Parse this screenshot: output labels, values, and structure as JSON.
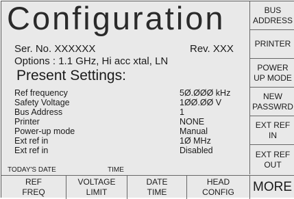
{
  "header": {
    "title": "Configuration"
  },
  "info": {
    "serial": "Ser. No. XXXXXX",
    "revision": "Rev. XXX",
    "options": "Options :  1.1  GHz, Hi acc xtal, LN",
    "present_settings": "Present Settings:"
  },
  "settings": [
    {
      "label": "Ref frequency",
      "value": "5Ø.ØØØ kHz"
    },
    {
      "label": "Safety Voltage",
      "value": "1ØØ.ØØ V"
    },
    {
      "label": "Bus Address",
      "value": "1"
    },
    {
      "label": "Printer",
      "value": "NONE"
    },
    {
      "label": "Power-up mode",
      "value": "Manual"
    },
    {
      "label": "Ext ref in",
      "value": "1Ø MHz"
    },
    {
      "label": "Ext ref in",
      "value": "Disabled"
    }
  ],
  "status": {
    "date_label": "TODAY'S DATE",
    "time_label": "TIME"
  },
  "side_keys": [
    "BUS\nADDRESS",
    "PRINTER",
    "POWER\nUP MODE",
    "NEW\nPASSWRD",
    "EXT REF\nIN",
    "EXT REF\nOUT"
  ],
  "bottom_keys": [
    "REF\nFREQ",
    "VOLTAGE\nLIMIT",
    "DATE\nTIME",
    "HEAD\nCONFIG"
  ],
  "more_label": "MORE"
}
